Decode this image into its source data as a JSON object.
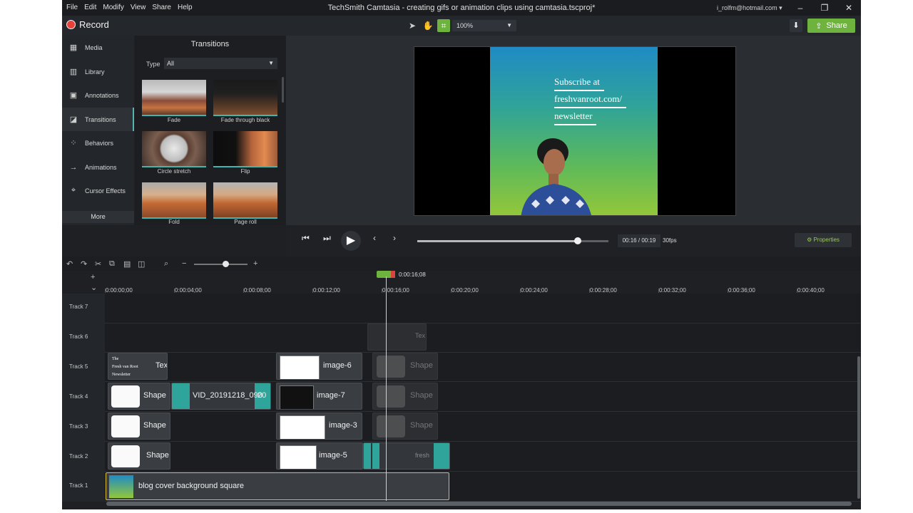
{
  "window": {
    "title": "TechSmith Camtasia - creating gifs or animation clips using camtasia.tscproj*",
    "account": "i_rolfm@hotmail.com",
    "menu": [
      "File",
      "Edit",
      "Modify",
      "View",
      "Share",
      "Help"
    ]
  },
  "toolbar": {
    "record_label": "Record",
    "zoom": "100%",
    "share_label": "Share"
  },
  "sidebar": {
    "items": [
      {
        "label": "Media",
        "icon": "film-icon"
      },
      {
        "label": "Library",
        "icon": "library-icon"
      },
      {
        "label": "Annotations",
        "icon": "annotation-icon"
      },
      {
        "label": "Transitions",
        "icon": "transition-icon"
      },
      {
        "label": "Behaviors",
        "icon": "behavior-icon"
      },
      {
        "label": "Animations",
        "icon": "animation-icon"
      },
      {
        "label": "Cursor Effects",
        "icon": "cursor-icon"
      }
    ],
    "active": "Transitions",
    "more_label": "More"
  },
  "transitions_panel": {
    "title": "Transitions",
    "type_label": "Type",
    "type_value": "All",
    "items": [
      "Fade",
      "Fade through black",
      "Circle stretch",
      "Flip",
      "Fold",
      "Page roll"
    ]
  },
  "canvas": {
    "poster_lines": [
      "Subscribe at",
      "freshvanroot.com/",
      "newsletter"
    ]
  },
  "playback": {
    "current_time": "00:16",
    "total_time": "00:19",
    "time_sep": "/",
    "fps": "30fps",
    "properties_label": "Properties",
    "progress": 0.84
  },
  "timeline": {
    "playhead_time": "0:00:16;08",
    "ruler": [
      "0:00:00;00",
      "0:00:04;00",
      "0:00:08;00",
      "0:00:12;00",
      "0:00:16;00",
      "0:00:20;00",
      "0:00:24;00",
      "0:00:28;00",
      "0:00:32;00",
      "0:00:36;00",
      "0:00:40;00"
    ],
    "tracks": [
      "Track 7",
      "Track 6",
      "Track 5",
      "Track 4",
      "Track 3",
      "Track 2",
      "Track 1"
    ],
    "clips": {
      "t6_ghost": "Tex",
      "t5_text_thumb": [
        "The",
        "Fresh van Root",
        "Newsletter"
      ],
      "t5_text": "Tex",
      "t5_image": "image-6",
      "t5_ghost": "Shape",
      "t4_shape": "Shape",
      "t4_video": "VID_20191218_090",
      "t4_video_tail": "20",
      "t4_image": "image-7",
      "t4_ghost": "Shape",
      "t3_shape": "Shape",
      "t3_image": "image-3",
      "t3_ghost": "Shape",
      "t2_shape": "Shape",
      "t2_image": "image-5",
      "t2_fresh": "fresh",
      "t1_bg": "blog cover background square"
    }
  }
}
